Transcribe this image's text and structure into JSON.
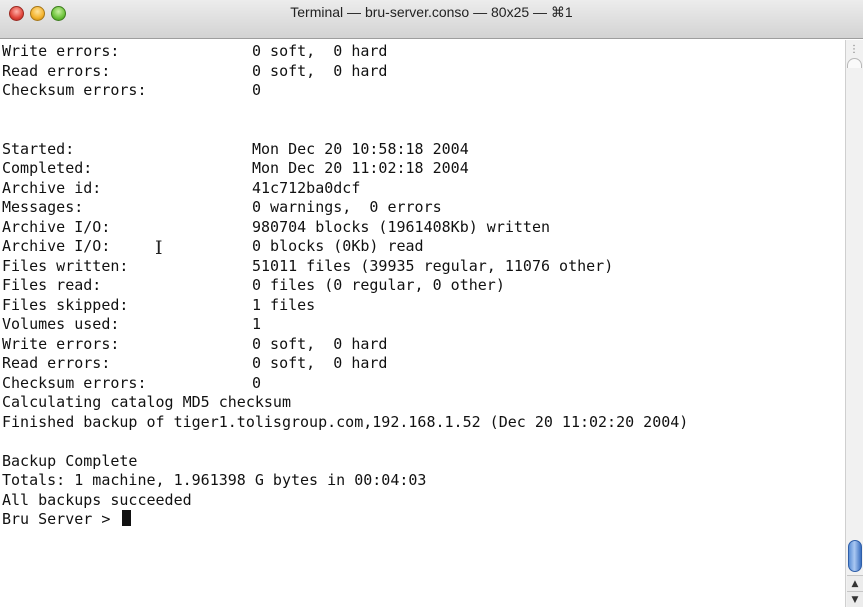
{
  "window": {
    "title": "Terminal — bru-server.conso — 80x25 — ⌘1"
  },
  "icons": {
    "close": "close-button",
    "minimize": "minimize-button",
    "zoom": "zoom-button",
    "ibeam": "ibeam-cursor-icon",
    "resize": "resize-grip-icon"
  },
  "colors": {
    "close": "#e0443a",
    "minimize": "#f3b22c",
    "zoom": "#6cc23a",
    "scroll_thumb": "#5b8fd6"
  },
  "terminal": {
    "lines": [
      {
        "label": "Write errors:",
        "value": "0 soft,  0 hard"
      },
      {
        "label": "Read errors:",
        "value": "0 soft,  0 hard"
      },
      {
        "label": "Checksum errors:",
        "value": "0"
      },
      {
        "text": ""
      },
      {
        "text": ""
      },
      {
        "label": "Started:",
        "value": "Mon Dec 20 10:58:18 2004"
      },
      {
        "label": "Completed:",
        "value": "Mon Dec 20 11:02:18 2004"
      },
      {
        "label": "Archive id:",
        "value": "41c712ba0dcf"
      },
      {
        "label": "Messages:",
        "value": "0 warnings,  0 errors"
      },
      {
        "label": "Archive I/O:",
        "value": "980704 blocks (1961408Kb) written"
      },
      {
        "label": "Archive I/O:",
        "value": "0 blocks (0Kb) read"
      },
      {
        "label": "Files written:",
        "value": "51011 files (39935 regular, 11076 other)"
      },
      {
        "label": "Files read:",
        "value": "0 files (0 regular, 0 other)"
      },
      {
        "label": "Files skipped:",
        "value": "1 files"
      },
      {
        "label": "Volumes used:",
        "value": "1"
      },
      {
        "label": "Write errors:",
        "value": "0 soft,  0 hard"
      },
      {
        "label": "Read errors:",
        "value": "0 soft,  0 hard"
      },
      {
        "label": "Checksum errors:",
        "value": "0"
      },
      {
        "text": "Calculating catalog MD5 checksum"
      },
      {
        "text": "Finished backup of tiger1.tolisgroup.com,192.168.1.52 (Dec 20 11:02:20 2004)"
      },
      {
        "text": ""
      },
      {
        "text": "Backup Complete"
      },
      {
        "text": "Totals: 1 machine, 1.961398 G bytes in 00:04:03"
      },
      {
        "text": "All backups succeeded"
      }
    ],
    "prompt": "Bru Server > "
  }
}
